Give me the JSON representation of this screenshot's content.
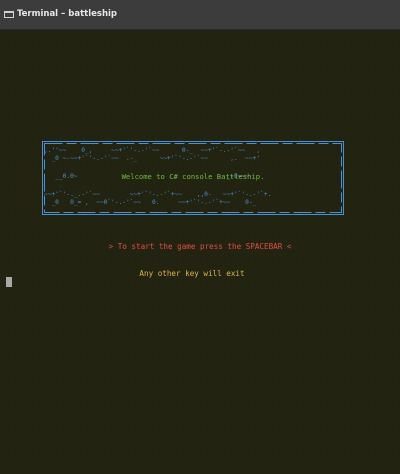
{
  "window": {
    "title": "Terminal – battleship",
    "icon": "terminal-icon"
  },
  "banner": {
    "welcome_text": "Welcome to C# console Battleship.",
    "frame_color": "#4a90d9",
    "welcome_color": "#6bbf3c",
    "wave_rows": [
      ",.''~~    0_,     ~~+'`'-.-'`~~      0-_  ~~+'`-.-'`~~   ,",
      "  _0 ~-~~+'`'-.-'`~~  .-_      ~~+'`'-.-'`~~      ,.  ~~+'",
      "   __0.0~                                        _-0~~~",
      "~~+'`'-._.-'`~~        ~~+'`'-.-'`+~~    ,,0-   ~~+'`'-.-'`+.",
      "  _0   0_= ,  ~~0`'-.-'`~~   0.     ~~+'`'-.-'`+~~    0-_"
    ]
  },
  "prompt": {
    "start_text": ">  To start the game press the SPACEBAR  <",
    "start_color": "#e34f3f",
    "exit_text": "Any other key will exit",
    "exit_color": "#e0b64a"
  },
  "colors": {
    "terminal_bg": "#222311",
    "titlebar_bg": "#3c3c3c",
    "cursor": "#a9a9a9"
  }
}
